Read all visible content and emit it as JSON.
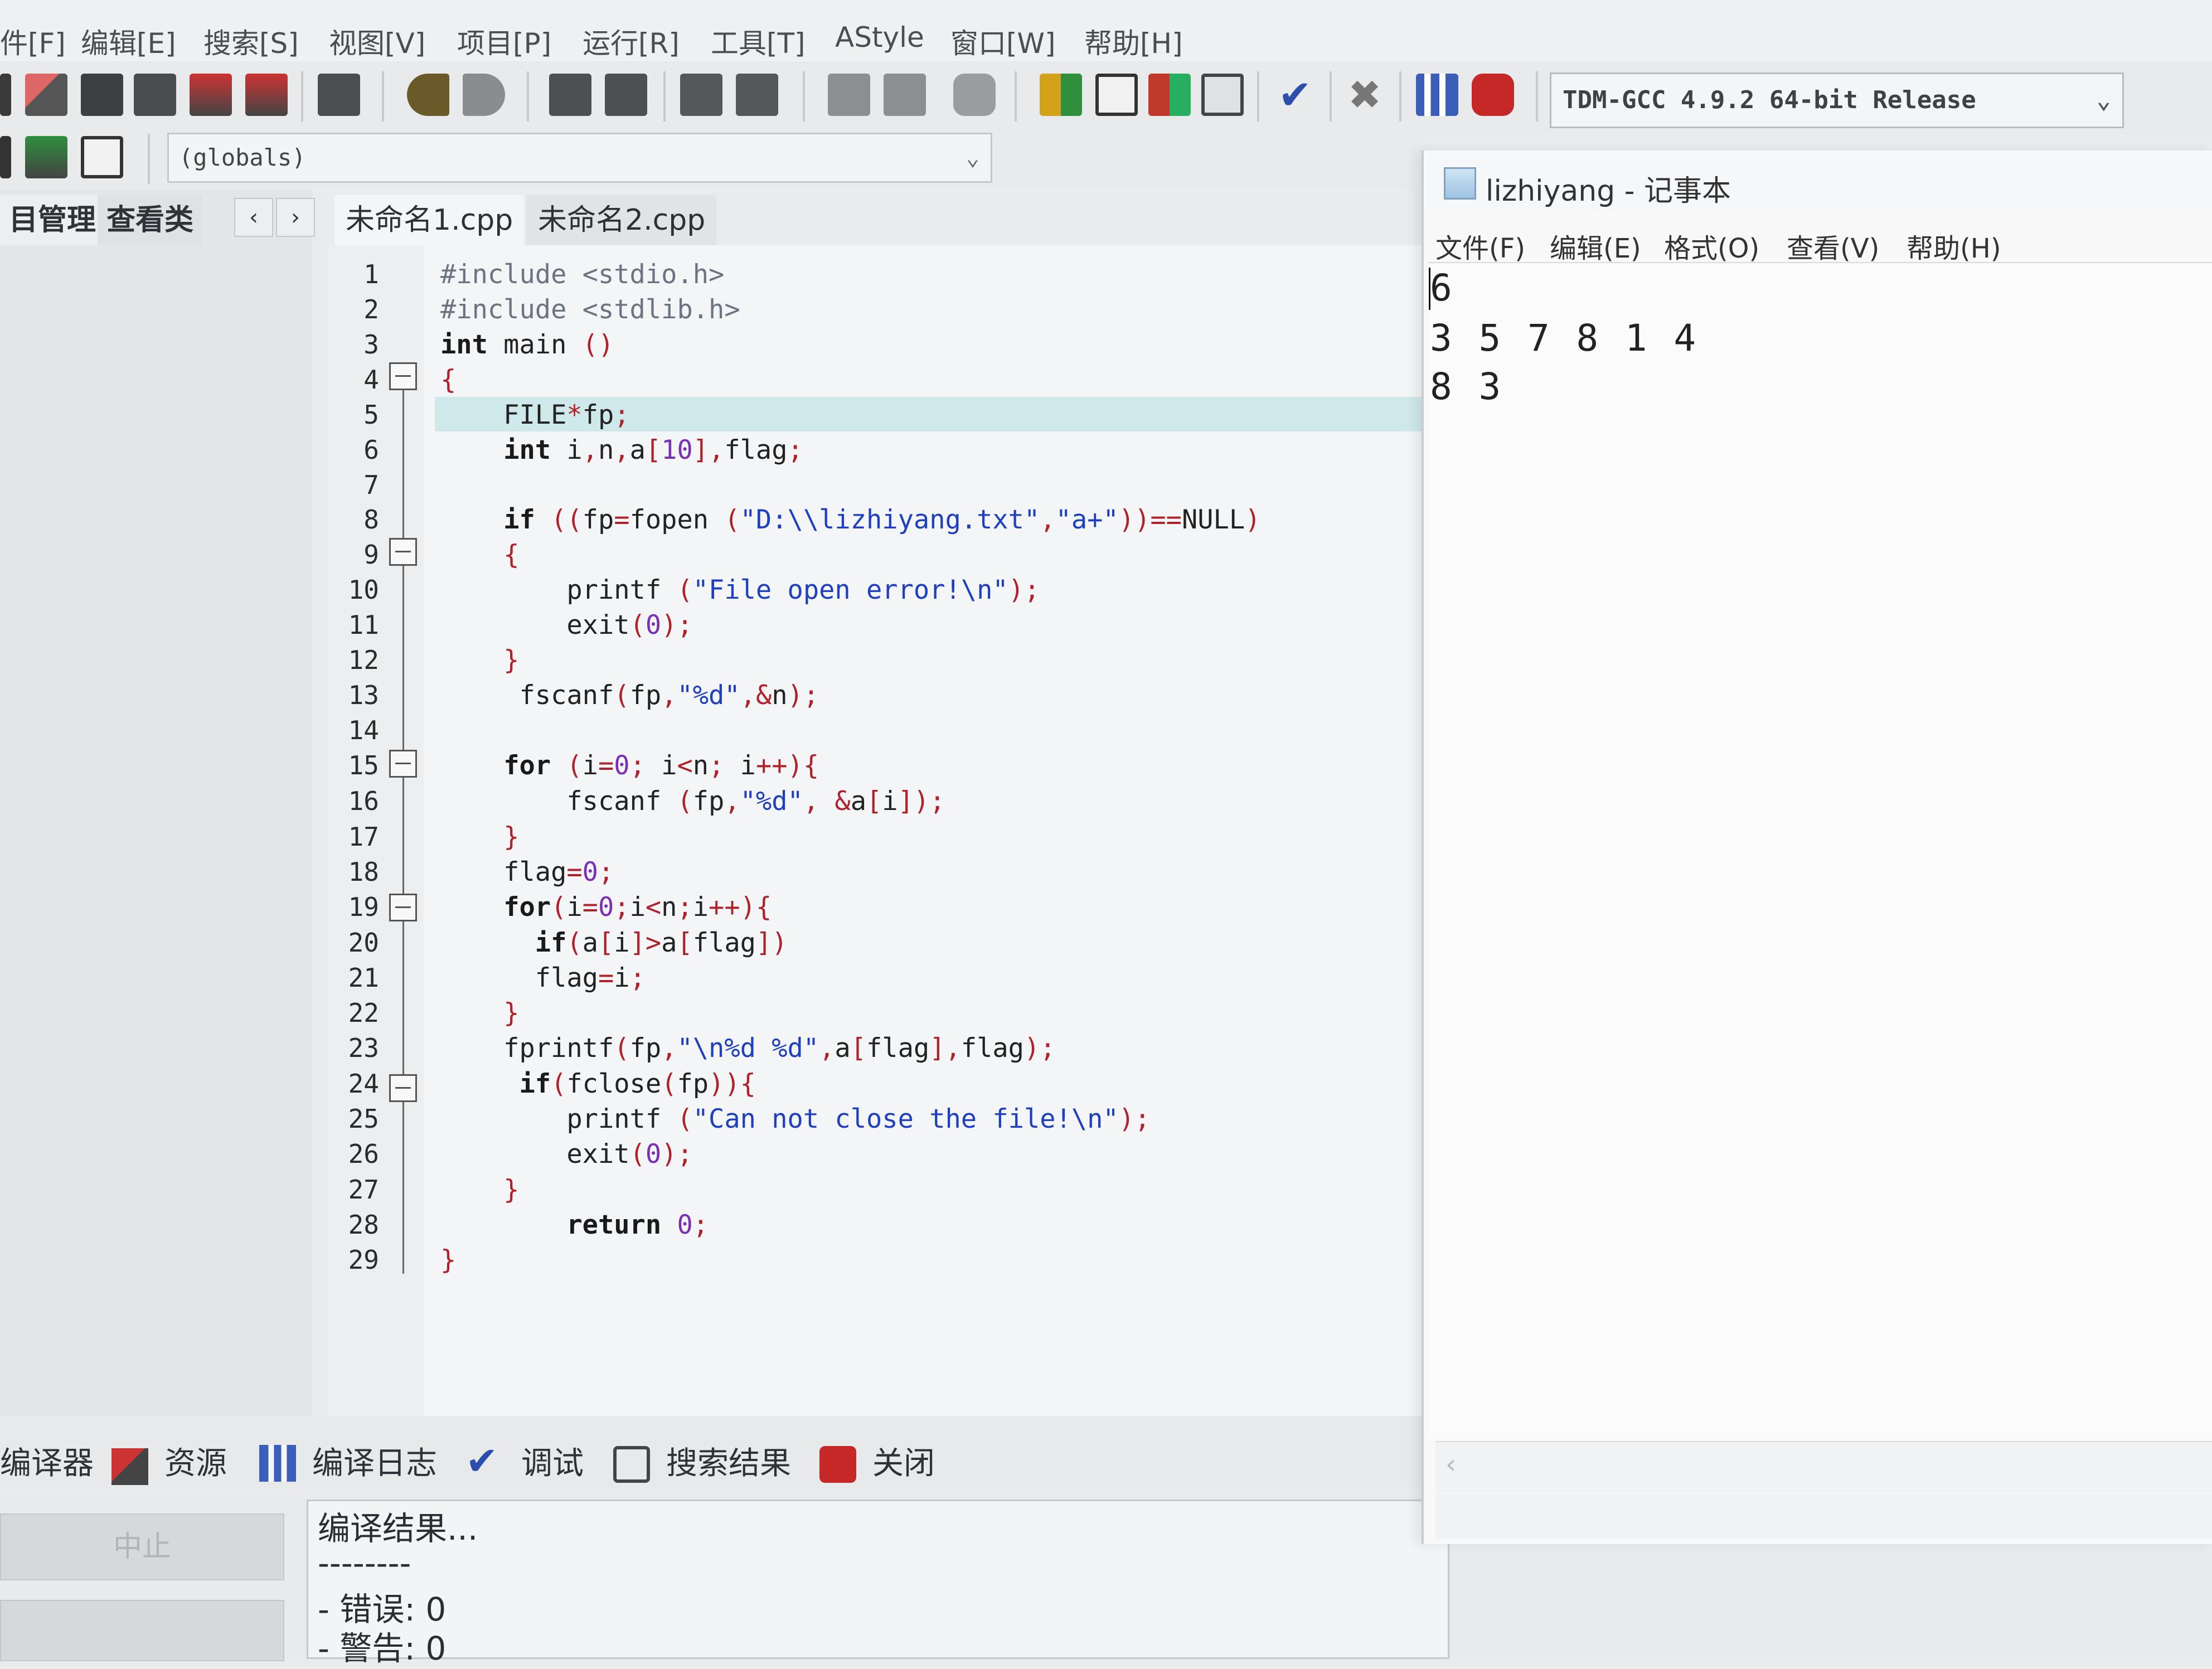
{
  "menubar": {
    "items": [
      "件[F]",
      "编辑[E]",
      "搜索[S]",
      "视图[V]",
      "项目[P]",
      "运行[R]",
      "工具[T]",
      "AStyle",
      "窗口[W]",
      "帮助[H]"
    ]
  },
  "toolbar": {
    "compiler": "TDM-GCC 4.9.2 64-bit Release",
    "globals": "(globals)"
  },
  "left_panel": {
    "tabs": [
      "目管理",
      "查看类"
    ]
  },
  "editor": {
    "tabs": [
      "未命名1.cpp",
      "未命名2.cpp"
    ],
    "line_numbers": [
      "1",
      "2",
      "3",
      "4",
      "5",
      "6",
      "7",
      "8",
      "9",
      "10",
      "11",
      "12",
      "13",
      "14",
      "15",
      "16",
      "17",
      "18",
      "19",
      "20",
      "21",
      "22",
      "23",
      "24",
      "25",
      "26",
      "27",
      "28",
      "29"
    ],
    "lines": [
      "#include <stdio.h>",
      "#include <stdlib.h>",
      "int main ()",
      "{",
      "    FILE*fp;",
      "    int i,n,a[10],flag;",
      "",
      "    if ((fp=fopen (\"D:\\\\lizhiyang.txt\",\"a+\"))==NULL)",
      "    {",
      "        printf (\"File open error!\\n\");",
      "        exit(0);",
      "    }",
      "     fscanf(fp,\"%d\",&n);",
      "",
      "    for (i=0; i<n; i++){",
      "        fscanf (fp,\"%d\", &a[i]);",
      "    }",
      "    flag=0;",
      "    for(i=0;i<n;i++){",
      "      if(a[i]>a[flag])",
      "      flag=i;",
      "    }",
      "    fprintf(fp,\"\\n%d %d\",a[flag],flag);",
      "     if(fclose(fp)){",
      "        printf (\"Can not close the file!\\n\");",
      "        exit(0);",
      "    }",
      "        return 0;",
      "}"
    ]
  },
  "bottom": {
    "tabs": [
      "编译器",
      "资源",
      "编译日志",
      "调试",
      "搜索结果",
      "关闭"
    ],
    "abort_label": "中止",
    "log": [
      "编译结果...",
      "--------",
      "- 错误: 0",
      "- 警告: 0"
    ]
  },
  "notepad": {
    "title": "lizhiyang - 记事本",
    "menu": [
      "文件(F)",
      "编辑(E)",
      "格式(O)",
      "查看(V)",
      "帮助(H)"
    ],
    "content": [
      "6",
      "3 5 7 8 1 4",
      "8 3"
    ]
  },
  "colors": {
    "string": "#1e3fc0",
    "number": "#7a2fb5",
    "symbol": "#b0222b",
    "current_line": "#cfe8ea"
  }
}
